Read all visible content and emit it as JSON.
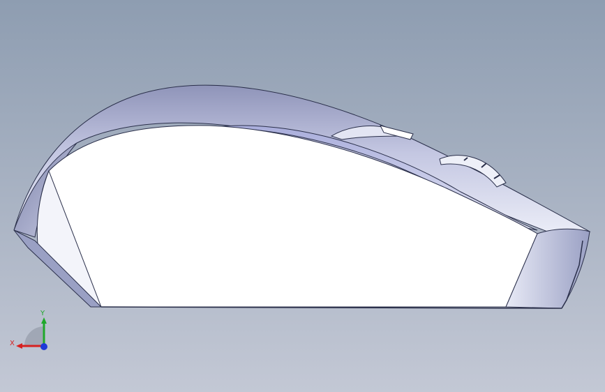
{
  "viewport": {
    "background_top": "#8e9db1",
    "background_bottom": "#c3c8d5"
  },
  "model": {
    "body_color": "#ffffff",
    "shell_color": "#c8cbe6",
    "shell_dark": "#8e93b8",
    "edge_color": "#2a2f4a"
  },
  "triad": {
    "x_label": "X",
    "y_label": "Y",
    "x_color": "#d62020",
    "y_color": "#1fa82a",
    "z_color": "#1e3ad8"
  }
}
